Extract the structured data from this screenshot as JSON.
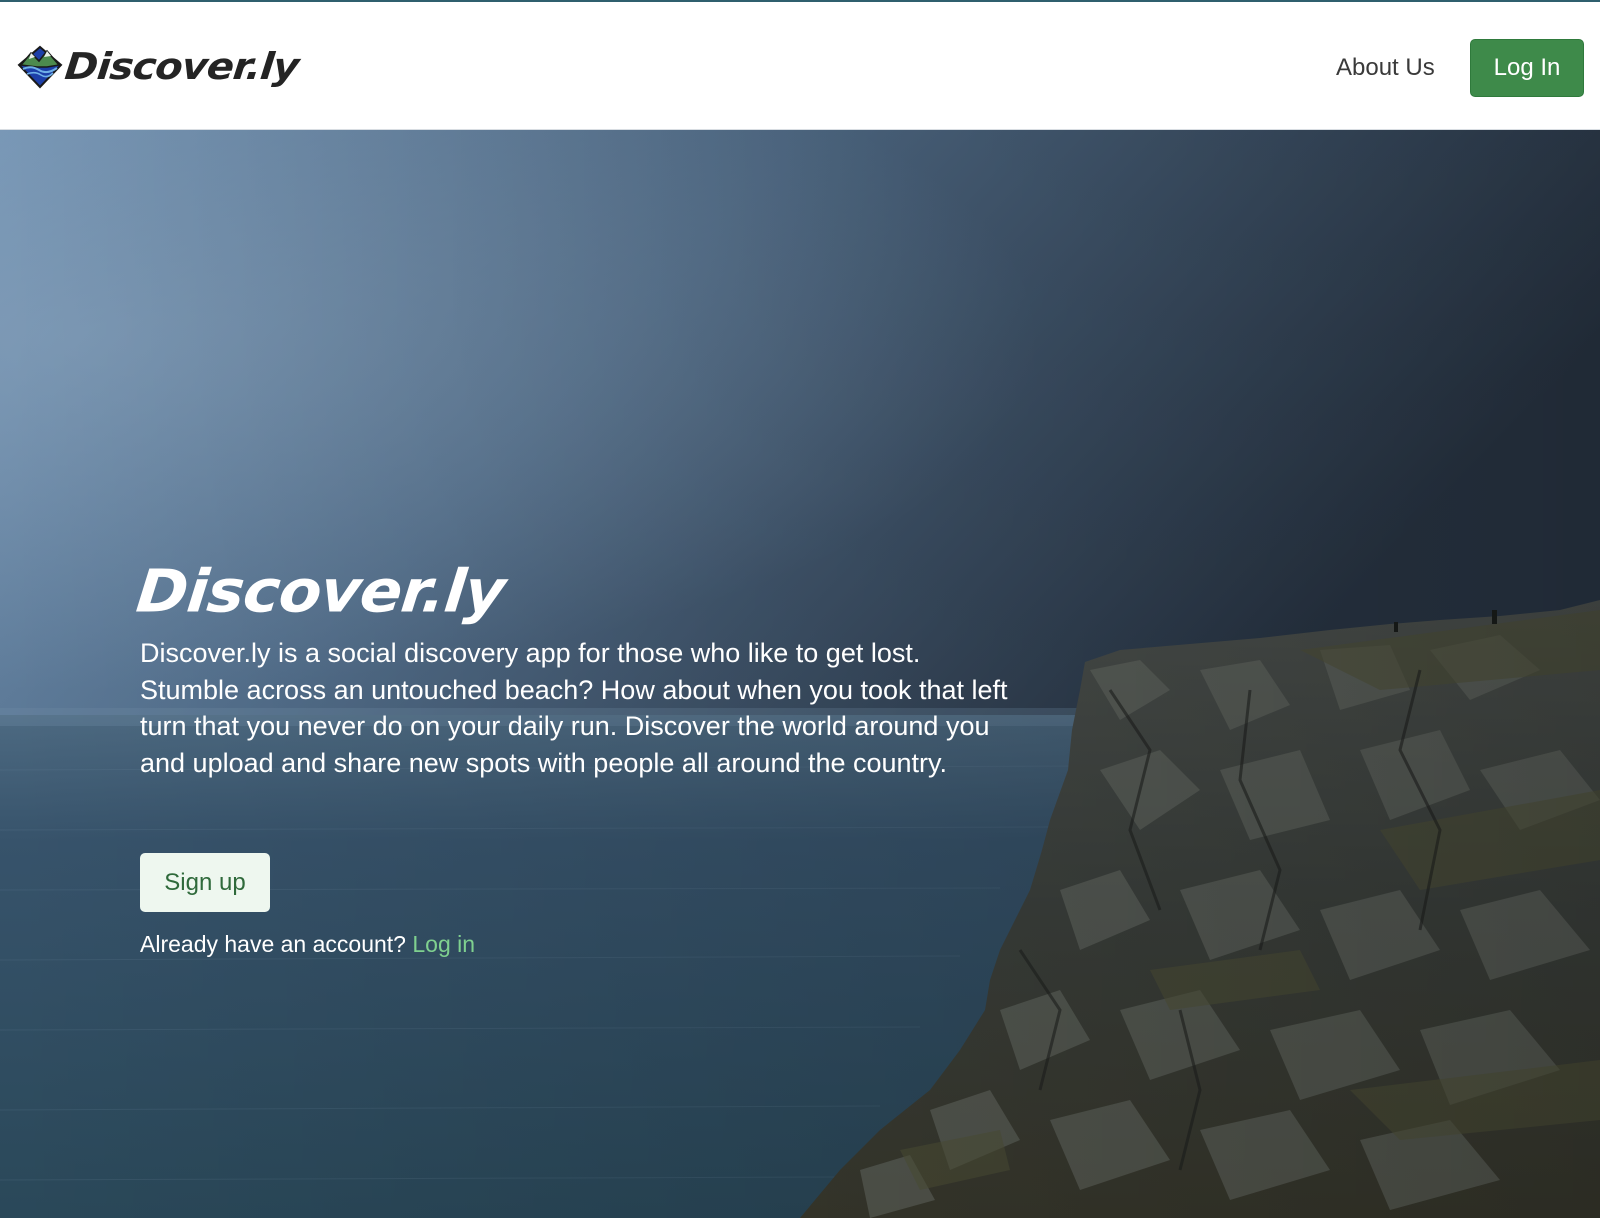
{
  "brand": {
    "name": "Discover.ly",
    "logo_icon": "mountain-diamond-logo-icon"
  },
  "nav": {
    "about_label": "About Us",
    "login_label": "Log In"
  },
  "hero": {
    "title": "Discover.ly",
    "description": "Discover.ly is a social discovery app for those who like to get lost. Stumble across an untouched beach? How about when you took that left turn that you never do on your daily run. Discover the world around you and upload and share new spots with people all around the country.",
    "signup_label": "Sign up",
    "account_prompt": "Already have an account?",
    "login_link_label": "Log in"
  },
  "colors": {
    "accent_green": "#3e8a4a",
    "link_green": "#7fd08f",
    "signup_bg": "#eef7ef",
    "navbar_bg": "#ffffff"
  }
}
